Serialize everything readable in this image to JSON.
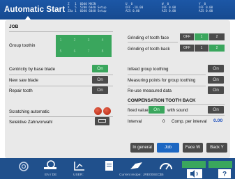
{
  "header": {
    "title": "Automatic Start",
    "axes_info_line1": "Z   1  6040 MAIN",
    "axes_info_line2": "X   5  5200 6040 Setup",
    "axes_info_line3": "ZXa 1  6040 6040 Setup",
    "u": {
      "label": "U  0",
      "l2": "OFF -10.00",
      "l3": "AIS 0.00"
    },
    "w": {
      "label": "W  0",
      "l2": "OFF 0.00",
      "l3": "AIS 0.00"
    },
    "y": {
      "label": "Y  0",
      "l2": "OFF 0.00",
      "l3": "AIS 0.00"
    }
  },
  "job": {
    "section_title": "JOB",
    "group_toothing_label": "Group toothin",
    "group_toothing_values": [
      "1",
      "2",
      "3",
      "4",
      "5",
      "6",
      "7",
      "8"
    ],
    "grinding_face_label": "Grinding of tooth face",
    "grinding_back_label": "Grinding of tooth back",
    "grind_face_buttons": [
      "OFF",
      "1",
      "2"
    ],
    "grind_back_buttons": [
      "OFF",
      "1",
      "2"
    ],
    "centricity_label": "Centricity by base blade",
    "new_saw_label": "New saw blade",
    "repair_label": "Repair tooth",
    "scratching_label": "Scratching automatic",
    "selektive_label": "Selektive Zahnvorwahl",
    "infeed_label": "Infeed group toothing",
    "measuring_label": "Measuring points for group toothing",
    "reuse_label": "Re-use measured data",
    "on_label": "On"
  },
  "compensation": {
    "title": "COMPENSATION TOOTH BACK",
    "fixed_value_label": "fixed value",
    "with_sound_label": "with sound",
    "interval_label": "Interval",
    "interval_value": "0",
    "comp_label": "Comp. per interval",
    "comp_value": "0.00"
  },
  "nav": {
    "in_general": "In general",
    "job": "Job",
    "face_w": "Face W",
    "back_y": "Back Y"
  },
  "footer": {
    "lang": "EN / DE",
    "user_label": "USER:",
    "recipe_label": "Current recipe:",
    "recipe_value": "JRE00SEC$5"
  },
  "colors": {
    "header_blue": "#1c57a6",
    "panel_gray": "#e9e9e9",
    "accent_green": "#3aa65d",
    "button_dark": "#4b4b4b",
    "active_blue": "#1d67c2",
    "value_blue": "#1d4fbf",
    "alarm_red": "#c9321a"
  }
}
